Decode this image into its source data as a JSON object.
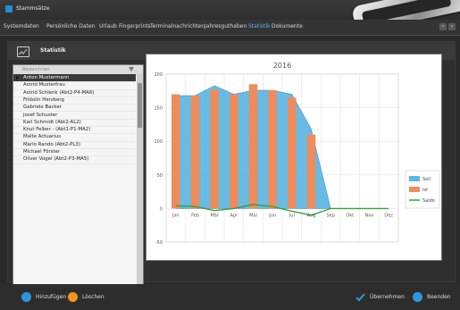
{
  "window": {
    "title": "Stammsätze"
  },
  "tabs": [
    {
      "label": "Systemdaten",
      "active": false
    },
    {
      "label": "Persönliche Daten",
      "active": false
    },
    {
      "label": "Urlaub",
      "active": false
    },
    {
      "label": "Fingerprints",
      "active": false
    },
    {
      "label": "Terminalnachrichten",
      "active": false
    },
    {
      "label": "Jahresguthaben",
      "active": false
    },
    {
      "label": "Statistik",
      "active": true
    },
    {
      "label": "Dokumente",
      "active": false
    }
  ],
  "panel": {
    "title": "Statistik",
    "icon": "chart-icon"
  },
  "list": {
    "header": "Bezeichner",
    "items": [
      "Anton Mustermann",
      "Astrid Musterfrau",
      "Astrid Schlenk (Abt2-P4-MA6)",
      "Fridolin Herzberg",
      "Gabriele Backer",
      "Josef Schuster",
      "Karl Schmidt (Abt2-AL2)",
      "Knut Felber - (Abt1-P1-MA2)",
      "Malte Actuarius",
      "Mario Rando (Abt2-PL3)",
      "Michael Förster",
      "Oliver Vogel (Abt2-P3-MA5)"
    ],
    "selected_index": 0
  },
  "colors": {
    "soll": "#5fb8e3",
    "ist": "#ef8c5b",
    "saldo": "#35a03a",
    "accent": "#2d97de",
    "orange": "#f2951f"
  },
  "chart_data": {
    "type": "bar",
    "title": "2016",
    "categories": [
      "Jan",
      "Feb",
      "Mär",
      "Apr",
      "Mai",
      "Jun",
      "Jul",
      "Aug",
      "Sep",
      "Okt",
      "Nov",
      "Dez"
    ],
    "ylim": [
      -50,
      200
    ],
    "yticks": [
      -50,
      0,
      50,
      100,
      150,
      200
    ],
    "grid": true,
    "legend_position": "right",
    "series": [
      {
        "name": "Soll",
        "kind": "area",
        "values": [
          168,
          168,
          183,
          170,
          176,
          176,
          170,
          118,
          0,
          0,
          0,
          0
        ]
      },
      {
        "name": "Ist",
        "kind": "bar",
        "values": [
          170,
          168,
          177,
          170,
          185,
          176,
          165,
          110,
          null,
          null,
          null,
          null
        ]
      },
      {
        "name": "Saldo",
        "kind": "line",
        "values": [
          4,
          3,
          -3,
          0,
          6,
          3,
          -4,
          -10,
          0,
          0,
          0,
          0
        ]
      }
    ]
  },
  "footer": {
    "add_label": "Hinzufügen",
    "delete_label": "Löschen",
    "apply_label": "Übernehmen",
    "close_label": "Beenden"
  }
}
